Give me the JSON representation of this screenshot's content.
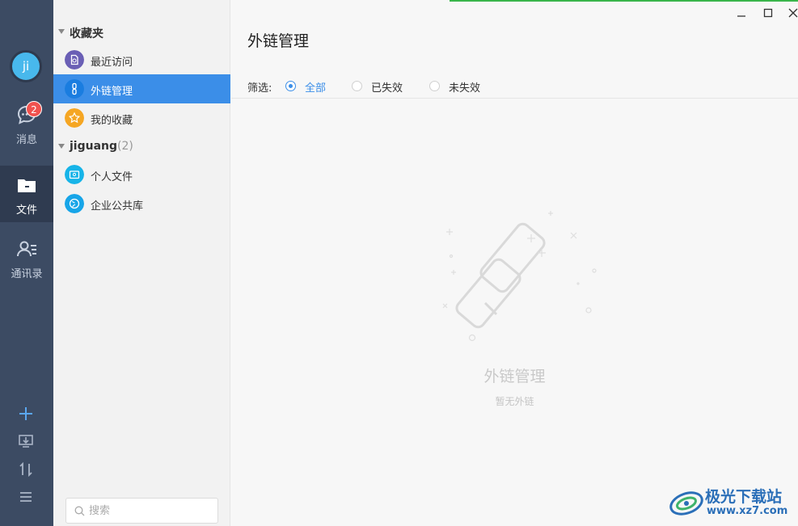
{
  "rail": {
    "avatar_text": "ji",
    "nav": [
      {
        "label": "消息",
        "badge": "2"
      },
      {
        "label": "文件"
      },
      {
        "label": "通讯录"
      }
    ]
  },
  "sidebar": {
    "favorites_group": "收藏夹",
    "favorites": [
      {
        "label": "最近访问",
        "color": "#6a5fb5"
      },
      {
        "label": "外链管理",
        "color": "#1a7de0"
      },
      {
        "label": "我的收藏",
        "color": "#f5a623"
      }
    ],
    "org_group": "jiguang",
    "org_count": "(2)",
    "org_items": [
      {
        "label": "个人文件",
        "color": "#17b4e8"
      },
      {
        "label": "企业公共库",
        "color": "#17a5e8"
      }
    ],
    "search_placeholder": "搜索"
  },
  "main": {
    "title": "外链管理",
    "filter_label": "筛选:",
    "filters": [
      {
        "label": "全部",
        "selected": true
      },
      {
        "label": "已失效",
        "selected": false
      },
      {
        "label": "未失效",
        "selected": false
      }
    ],
    "empty_title": "外链管理",
    "empty_subtitle": "暂无外链"
  },
  "watermark": {
    "name": "极光下载站",
    "url": "www.xz7.com"
  },
  "colors": {
    "accent": "#3b8ee8",
    "rail": "#3c4b63",
    "badge": "#f0524f"
  }
}
